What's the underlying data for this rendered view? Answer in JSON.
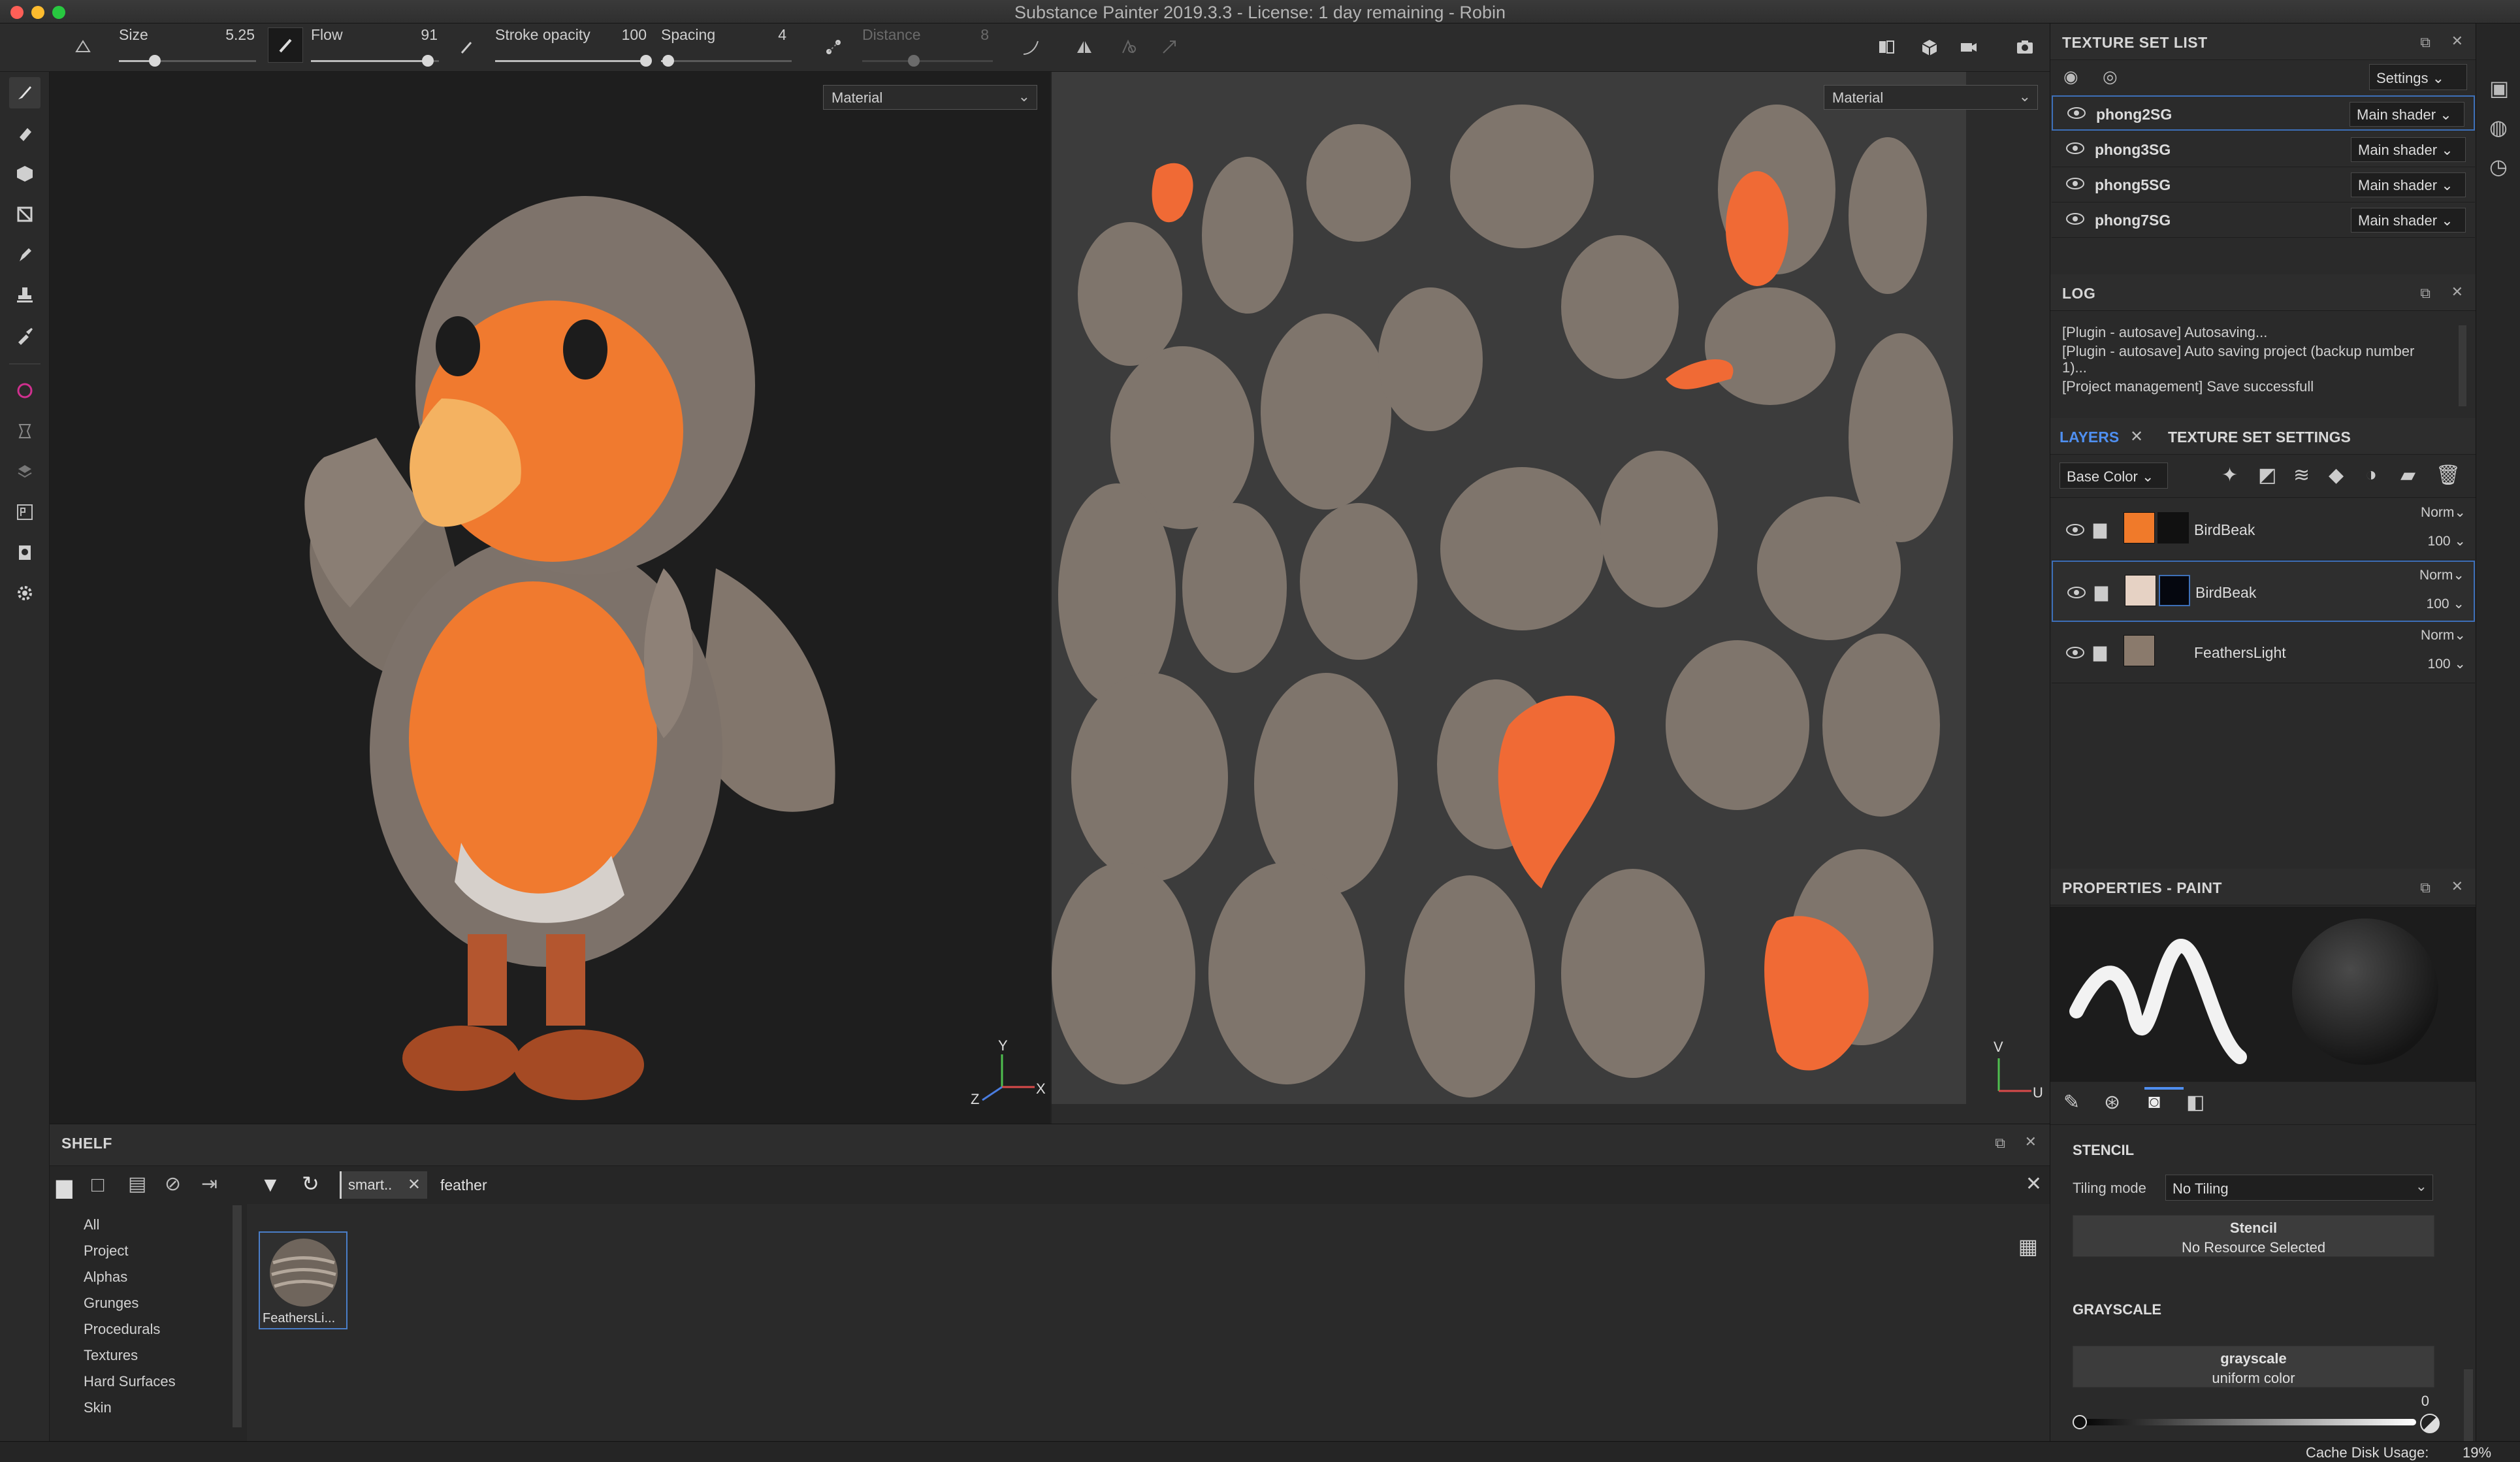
{
  "window": {
    "title": "Substance Painter 2019.3.3 - License: 1 day remaining - Robin",
    "traffic_lights": {
      "close": "#fe5f57",
      "minimize": "#febc2e",
      "zoom": "#28c840"
    }
  },
  "toolbar": {
    "size": {
      "label": "Size",
      "value": "5.25",
      "level": 0.26
    },
    "flow": {
      "label": "Flow",
      "value": "91",
      "level": 0.91
    },
    "stroke_opacity": {
      "label": "Stroke opacity",
      "value": "100",
      "level": 1.0
    },
    "spacing": {
      "label": "Spacing",
      "value": "4",
      "level": 0.04
    },
    "distance": {
      "label": "Distance",
      "value": "8",
      "level": 0.25
    }
  },
  "viewport_3d": {
    "mode_select": "Material",
    "axes": {
      "x": "X",
      "y": "Y",
      "z": "Z"
    }
  },
  "viewport_2d": {
    "mode_select": "Material",
    "axes": {
      "v": "V",
      "u": "U"
    }
  },
  "texture_set_list": {
    "title": "TEXTURE SET LIST",
    "settings_label": "Settings",
    "rows": [
      {
        "name": "phong2SG",
        "shader": "Main shader",
        "selected": true
      },
      {
        "name": "phong3SG",
        "shader": "Main shader",
        "selected": false
      },
      {
        "name": "phong5SG",
        "shader": "Main shader",
        "selected": false
      },
      {
        "name": "phong7SG",
        "shader": "Main shader",
        "selected": false
      }
    ]
  },
  "log": {
    "title": "LOG",
    "lines": [
      "[Plugin - autosave] Autosaving...",
      "[Plugin - autosave] Auto saving project (backup number",
      "1)...",
      "[Project management] Save successfull"
    ]
  },
  "layers": {
    "tab_layers": "LAYERS",
    "tab_texture_set_settings": "TEXTURE SET SETTINGS",
    "channel_select": "Base Color",
    "rows": [
      {
        "name": "BirdBeak",
        "blend": "Norm",
        "opacity": "100",
        "color": "#f07a2a",
        "mask": "#111111",
        "selected": false
      },
      {
        "name": "BirdBeak",
        "blend": "Norm",
        "opacity": "100",
        "color": "#e6d2c4",
        "mask": "#05070f",
        "selected": true
      },
      {
        "name": "FeathersLight",
        "blend": "Norm",
        "opacity": "100",
        "color": "#8a7a6c",
        "mask": "",
        "selected": false
      }
    ]
  },
  "properties": {
    "title": "PROPERTIES - PAINT",
    "stencil_heading": "STENCIL",
    "tiling_label": "Tiling mode",
    "tiling_value": "No Tiling",
    "stencil_button_title": "Stencil",
    "stencil_button_sub": "No Resource Selected",
    "grayscale_heading": "GRAYSCALE",
    "grayscale_button_title": "grayscale",
    "grayscale_button_sub": "uniform color",
    "grayscale_value": "0"
  },
  "shelf": {
    "title": "SHELF",
    "filter_tag": "smart..",
    "search_value": "feather",
    "categories": [
      "All",
      "Project",
      "Alphas",
      "Grunges",
      "Procedurals",
      "Textures",
      "Hard Surfaces",
      "Skin"
    ],
    "items": [
      {
        "label": "FeathersLi..."
      }
    ]
  },
  "status": {
    "cache_label": "Cache Disk Usage:",
    "cache_value": "19%"
  }
}
